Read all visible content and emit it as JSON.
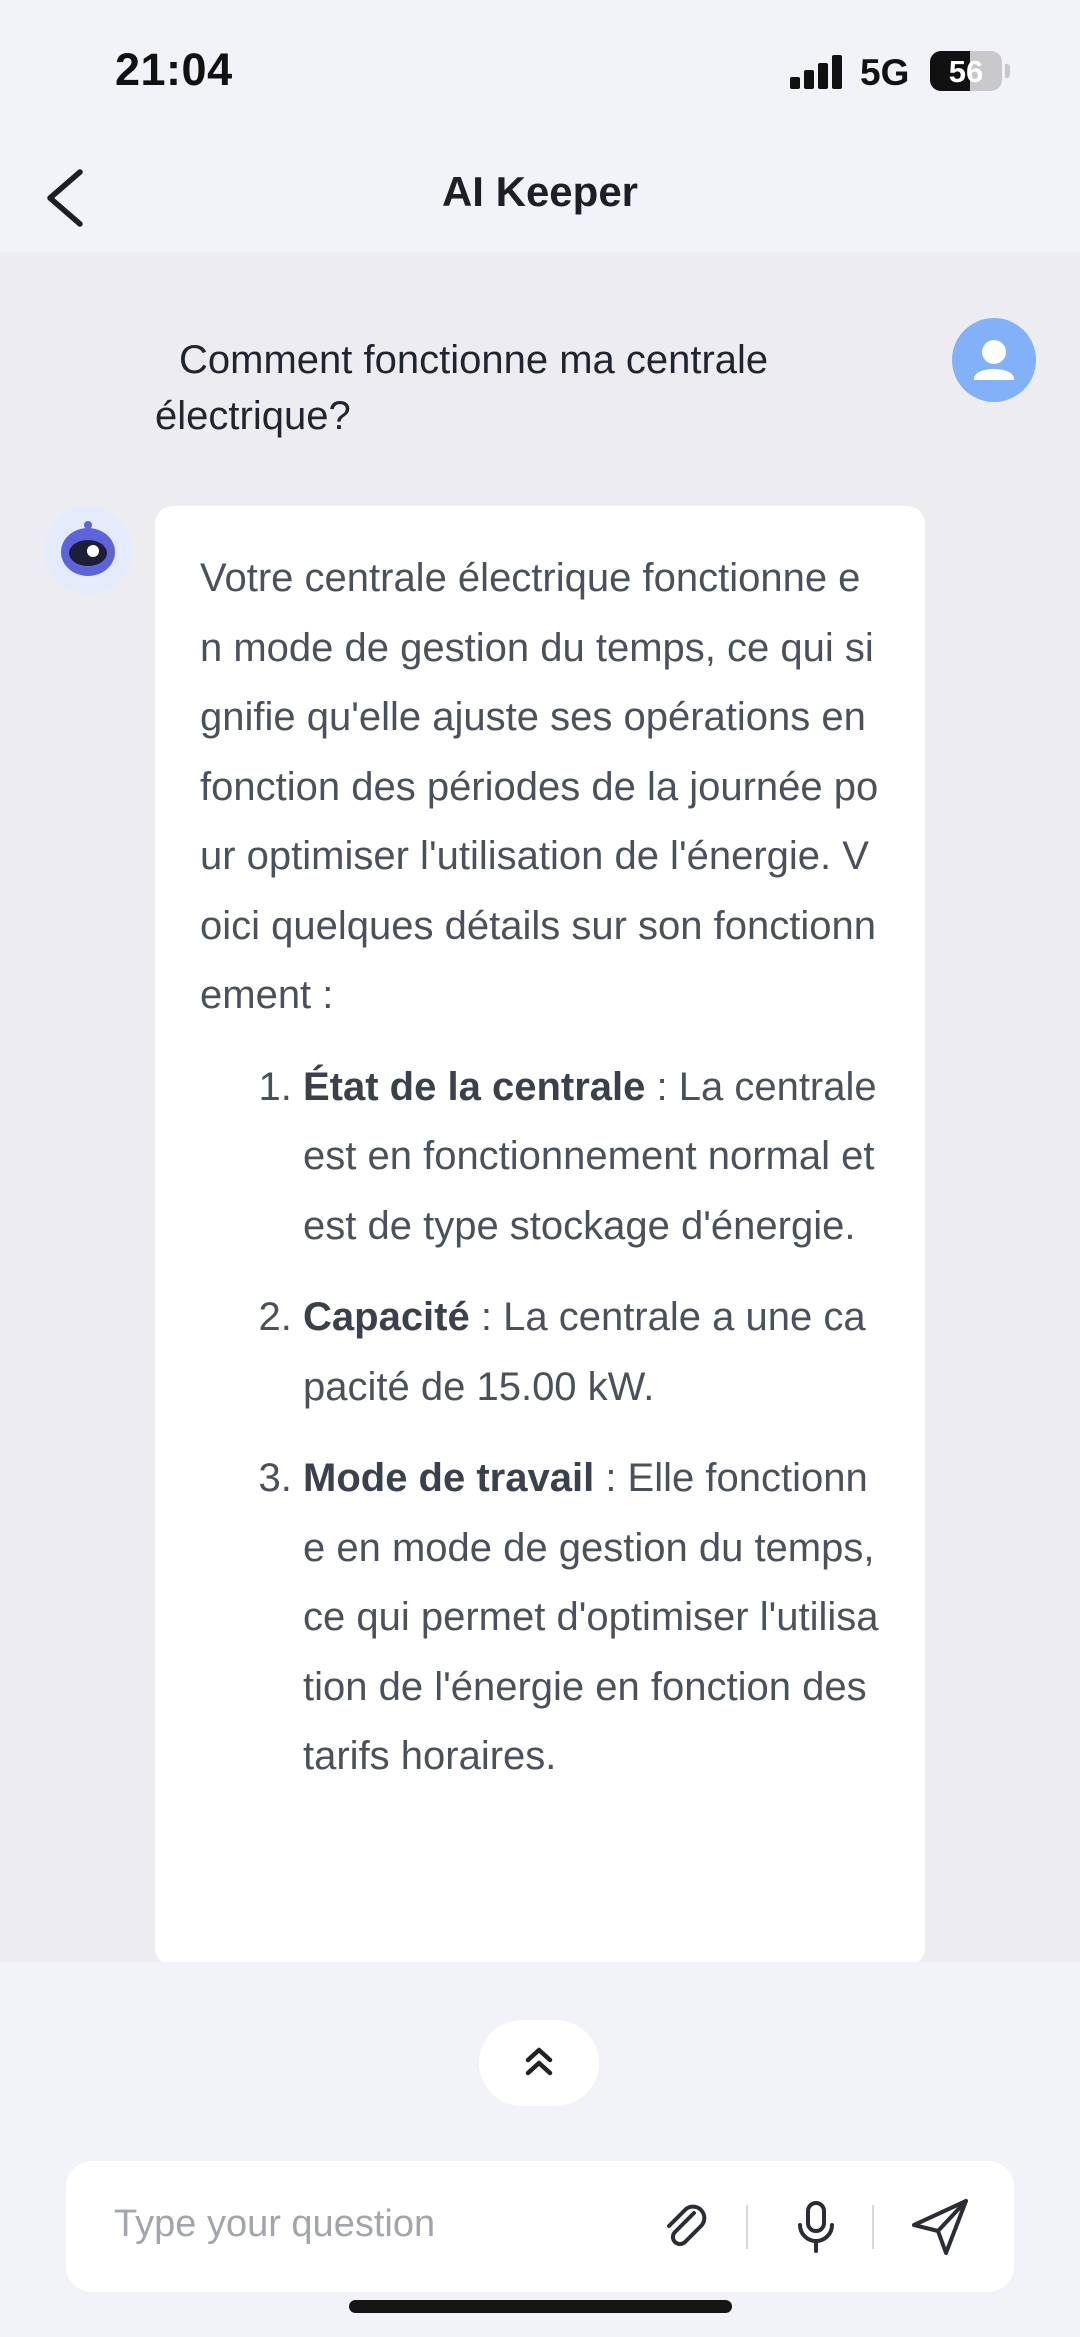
{
  "status_bar": {
    "time": "21:04",
    "network": "5G",
    "battery_level": "56",
    "battery_fraction": 0.56,
    "signal_bars": 4
  },
  "header": {
    "title": "AI Keeper",
    "back_icon": "chevron-left-icon"
  },
  "chat": {
    "user_message": "Comment fonctionne ma centrale électrique?",
    "bot_intro": "Votre centrale électrique fonctionne en mode de gestion du temps, ce qui signifie qu'elle ajuste ses opérations en fonction des périodes de la journée pour optimiser l'utilisation de l'énergie. Voici quelques détails sur son fonctionnement :",
    "bot_items": [
      {
        "title": "État de la centrale",
        "text": " : La centrale est en fonctionnement normal et est de type stockage d'énergie."
      },
      {
        "title": "Capacité",
        "text": " : La centrale a une capacité de 15.00 kW."
      },
      {
        "title": "Mode de travail",
        "text": " : Elle fonctionne en mode de gestion du temps, ce qui permet d'optimiser l'utilisation de l'énergie en fonction des tarifs horaires."
      }
    ]
  },
  "input": {
    "placeholder": "Type your question",
    "icons": [
      "paperclip-icon",
      "microphone-icon",
      "send-icon"
    ]
  },
  "scroll_button": {
    "icon": "double-chevron-up-icon"
  },
  "colors": {
    "background": "#f2f3f8",
    "chat_background": "#ededf1",
    "user_avatar": "#82b0f9",
    "bubble": "#ffffff"
  }
}
